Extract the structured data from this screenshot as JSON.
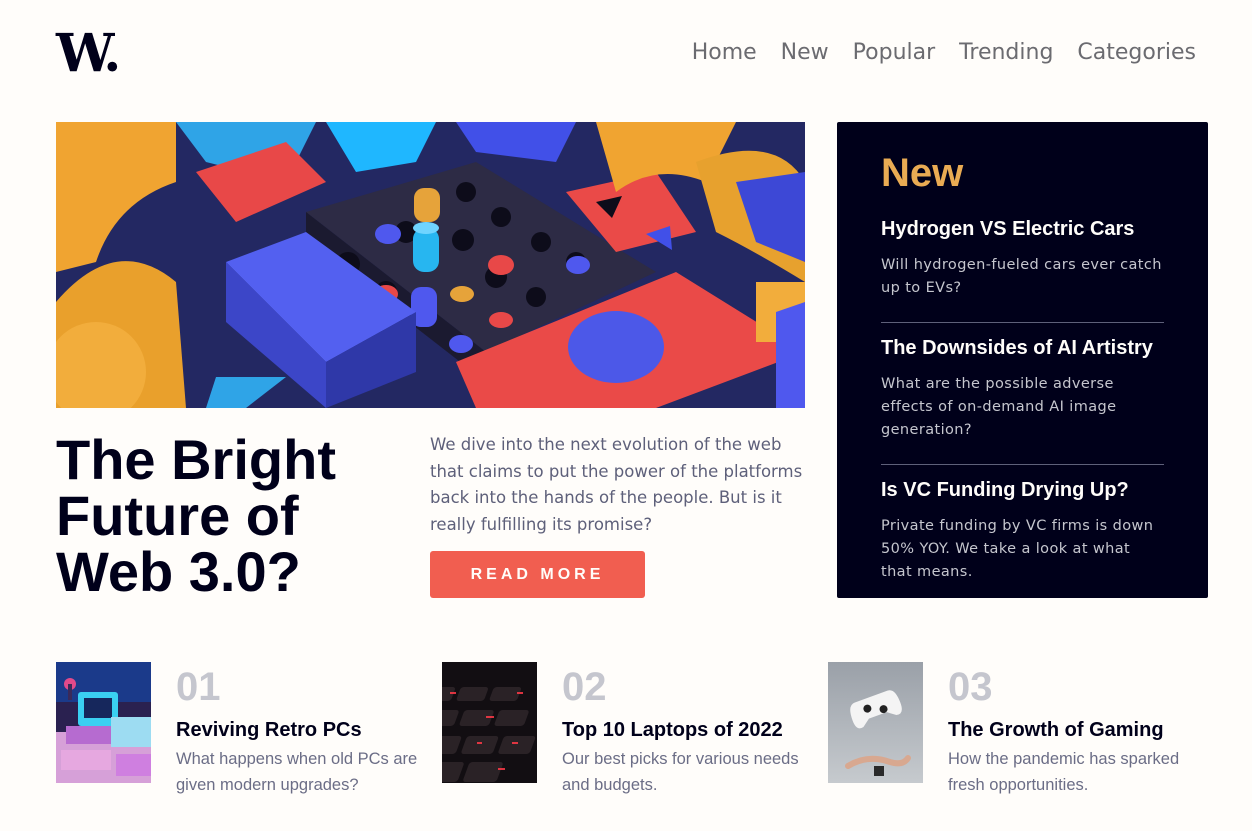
{
  "logo": "W.",
  "nav": {
    "items": [
      "Home",
      "New",
      "Popular",
      "Trending",
      "Categories"
    ]
  },
  "hero": {
    "title": "The Bright Future of Web 3.0?",
    "description": "We dive into the next evolution of the web that claims to put the power of the platforms back into the hands of the people. But is it really fulfilling its promise?",
    "button_label": "READ MORE"
  },
  "new_panel": {
    "heading": "New",
    "items": [
      {
        "title": "Hydrogen VS Electric Cars",
        "description": "Will hydrogen-fueled cars ever catch up to EVs?"
      },
      {
        "title": "The Downsides of AI Artistry",
        "description": "What are the possible adverse effects of on-demand AI image generation?"
      },
      {
        "title": "Is VC Funding Drying Up?",
        "description": "Private funding by VC firms is down 50% YOY. We take a look at what that means."
      }
    ]
  },
  "cards": [
    {
      "number": "01",
      "title": "Reviving Retro PCs",
      "description": "What happens when old PCs are given modern upgrades?"
    },
    {
      "number": "02",
      "title": "Top 10 Laptops of 2022",
      "description": "Our best picks for various needs and budgets."
    },
    {
      "number": "03",
      "title": "The Growth of Gaming",
      "description": "How the pandemic has sparked fresh opportunities."
    }
  ],
  "colors": {
    "background": "#fffdfa",
    "dark_navy": "#00001a",
    "accent_red": "#f15e50",
    "accent_orange": "#e9ab53",
    "grayish_blue": "#5e607a"
  }
}
